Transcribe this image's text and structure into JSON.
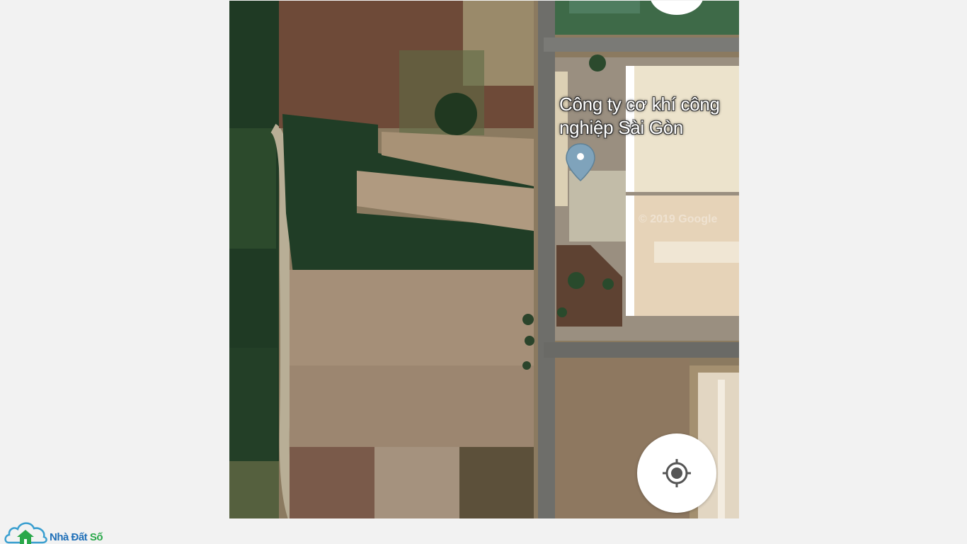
{
  "map": {
    "place_name": "Công ty cơ khí công nghiệp Sài Gòn",
    "watermark": "© 2019 Google",
    "marker_icon": "map-pin-icon",
    "locate_icon": "my-location-icon",
    "colors": {
      "marker": "#7fa3bb",
      "road": "#6f6f6f",
      "roof": "#e8dcc4"
    }
  },
  "logo": {
    "part1": "Nhà Đất ",
    "part2": "Số",
    "icon": "cloud-house-icon",
    "colors": {
      "primary": "#1f6fb8",
      "secondary": "#2aa84a"
    }
  }
}
